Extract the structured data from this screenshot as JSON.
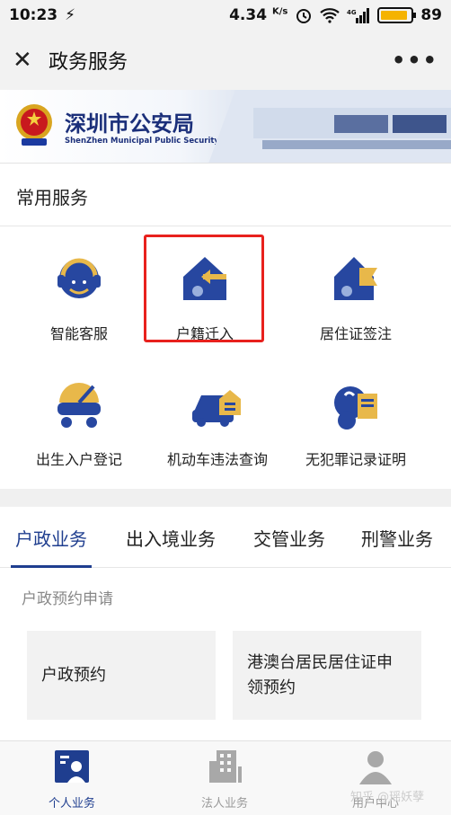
{
  "status_bar": {
    "time": "10:23",
    "speed": "4.34",
    "speed_unit": "K/s",
    "battery": "89",
    "battery_level": 0.89,
    "signal_type": "4G"
  },
  "nav": {
    "close_icon": "close-icon",
    "title": "政务服务",
    "more_icon": "more-icon"
  },
  "banner": {
    "title_cn": "深圳市公安局",
    "title_en": "ShenZhen Municipal Public Security Bureau"
  },
  "common": {
    "title": "常用服务",
    "items": [
      {
        "label": "智能客服",
        "icon": "customer-service-icon"
      },
      {
        "label": "户籍迁入",
        "icon": "household-move-in-icon"
      },
      {
        "label": "居住证签注",
        "icon": "residence-permit-icon"
      },
      {
        "label": "出生入户登记",
        "icon": "birth-registration-icon"
      },
      {
        "label": "机动车违法查询",
        "icon": "vehicle-violation-icon"
      },
      {
        "label": "无犯罪记录证明",
        "icon": "no-criminal-record-icon"
      }
    ]
  },
  "tabs": [
    "户政业务",
    "出入境业务",
    "交管业务",
    "刑警业务"
  ],
  "active_tab": "户政业务",
  "section": {
    "title": "户政预约申请",
    "cards": [
      "户政预约",
      "港澳台居民居住证申领预约"
    ]
  },
  "bottom_nav": [
    {
      "label": "个人业务",
      "icon": "person-card-icon"
    },
    {
      "label": "法人业务",
      "icon": "building-icon"
    },
    {
      "label": "用户中心",
      "icon": "user-icon"
    }
  ],
  "watermark": "知乎 @瑶妖孽",
  "colors": {
    "brand_blue": "#1f3e8f",
    "accent_yellow": "#e8b84a",
    "highlight_red": "#e8211d"
  }
}
